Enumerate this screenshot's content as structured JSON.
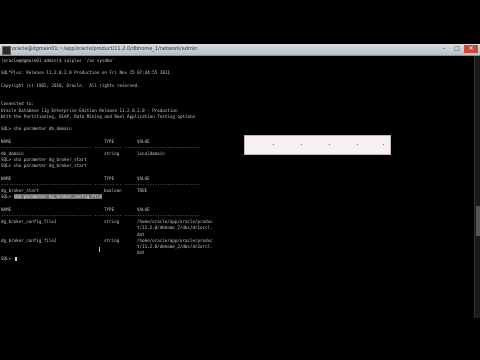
{
  "window": {
    "title": "oracle@dgmain01:~/app/oracle/product/11.2.0/dbhome_1/network/admin",
    "minimize_label": "–",
    "maximize_label": "□",
    "close_label": "✕"
  },
  "console": {
    "lines": [
      {
        "text": "[oracle@dgmain01 admin]$ sqlplus '/as sysdba'"
      },
      {
        "text": ""
      },
      {
        "text": "SQL*Plus: Release 11.2.0.2.0 Production on Fri Nov 25 07:44:55 2011"
      },
      {
        "text": ""
      },
      {
        "text": "Copyright (c) 1982, 2010, Oracle.  All rights reserved."
      },
      {
        "text": ""
      },
      {
        "text": ""
      },
      {
        "text": "Connected to:"
      },
      {
        "text": "Oracle Database 11g Enterprise Edition Release 11.2.0.2.0 - Production"
      },
      {
        "text": "With the Partitioning, OLAP, Data Mining and Real Application Testing options"
      },
      {
        "text": ""
      },
      {
        "text": "SQL> sho parameter db_domain"
      },
      {
        "text": ""
      },
      {
        "name": "NAME",
        "type": "TYPE",
        "value": "VALUE"
      },
      {
        "text": "------------------------------------ ----------- ------------------------------"
      },
      {
        "name": "db_domain",
        "type": "string",
        "value": "localdomain"
      },
      {
        "text": "SQL> sho parameter dg_broker_start"
      },
      {
        "text": "SQL> sho parameter dg_broker_start"
      },
      {
        "text": ""
      },
      {
        "name": "NAME",
        "type": "TYPE",
        "value": "VALUE"
      },
      {
        "text": "------------------------------------ ----------- ------------------------------"
      },
      {
        "name": "dg_broker_start",
        "type": "boolean",
        "value": "TRUE"
      },
      {
        "text": "SQL> sho parameter dg_broker_config_file",
        "selected": "sho parameter dg_broker_config_file"
      },
      {
        "text": ""
      },
      {
        "name": "NAME",
        "type": "TYPE",
        "value": "VALUE"
      },
      {
        "text": "------------------------------------ ----------- ------------------------------"
      },
      {
        "name": "dg_broker_config_file1",
        "type": "string",
        "value": "/home/oracle/app/oracle/produc"
      },
      {
        "value": "t/11.2.0/dbhome_2/dbs/dr1orcl."
      },
      {
        "value": "dat"
      },
      {
        "name": "dg_broker_config_file2",
        "type": "string",
        "value": "/home/oracle/app/oracle/produc"
      },
      {
        "value": "t/11.2.0/dbhome_2/dbs/dr2orcl."
      },
      {
        "value": "dat"
      },
      {
        "text": "SQL> "
      }
    ]
  }
}
